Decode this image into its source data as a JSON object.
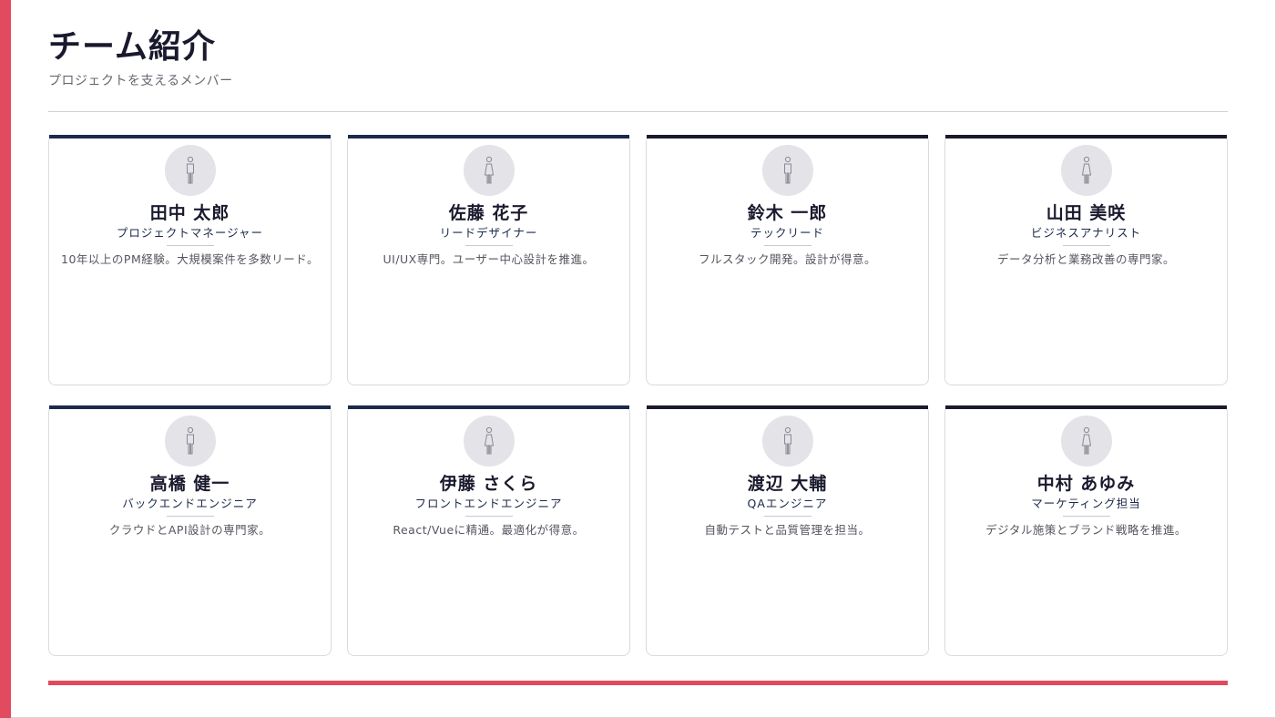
{
  "header": {
    "title": "チーム紹介",
    "subtitle": "プロジェクトを支えるメンバー"
  },
  "colors": {
    "accent": "#e14a5f",
    "navy": "#1b2a4a",
    "dark": "#1a1a2e"
  },
  "members": [
    {
      "name": "田中 太郎",
      "role": "プロジェクトマネージャー",
      "desc": "10年以上のPM経験。大規模案件を多数リード。",
      "icon": "person-male-icon"
    },
    {
      "name": "佐藤 花子",
      "role": "リードデザイナー",
      "desc": "UI/UX専門。ユーザー中心設計を推進。",
      "icon": "person-female-icon"
    },
    {
      "name": "鈴木 一郎",
      "role": "テックリード",
      "desc": "フルスタック開発。設計が得意。",
      "icon": "person-male-icon"
    },
    {
      "name": "山田 美咲",
      "role": "ビジネスアナリスト",
      "desc": "データ分析と業務改善の専門家。",
      "icon": "person-female-icon"
    },
    {
      "name": "高橋 健一",
      "role": "バックエンドエンジニア",
      "desc": "クラウドとAPI設計の専門家。",
      "icon": "person-male-icon"
    },
    {
      "name": "伊藤 さくら",
      "role": "フロントエンドエンジニア",
      "desc": "React/Vueに精通。最適化が得意。",
      "icon": "person-female-icon"
    },
    {
      "name": "渡辺 大輔",
      "role": "QAエンジニア",
      "desc": "自動テストと品質管理を担当。",
      "icon": "person-male-icon"
    },
    {
      "name": "中村 あゆみ",
      "role": "マーケティング担当",
      "desc": "デジタル施策とブランド戦略を推進。",
      "icon": "person-female-icon"
    }
  ]
}
